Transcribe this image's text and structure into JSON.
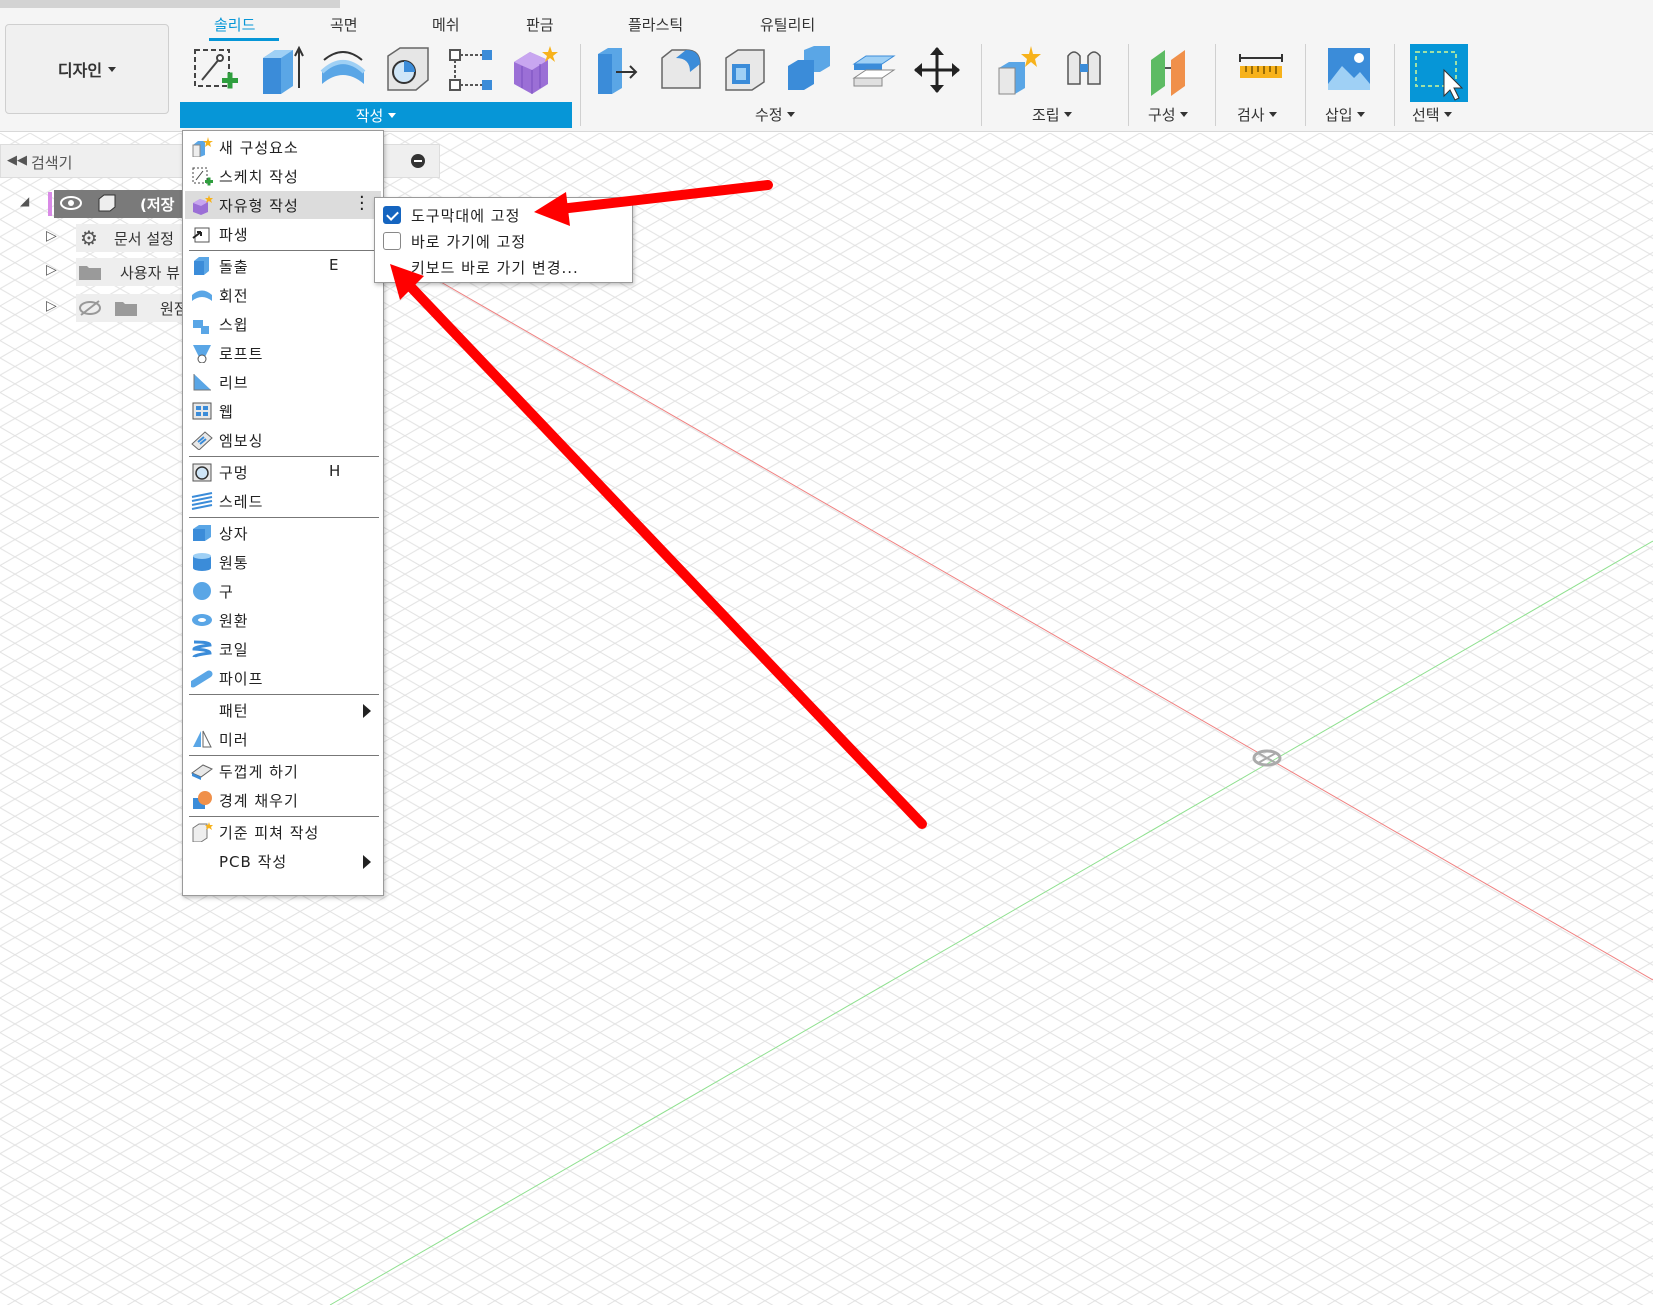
{
  "toolbar": {
    "workspace_label": "디자인",
    "tabs": [
      "솔리드",
      "곡면",
      "메쉬",
      "판금",
      "플라스틱",
      "유틸리티"
    ],
    "active_tab": "솔리드",
    "groups": {
      "create": "작성",
      "modify": "수정",
      "assemble": "조립",
      "construct": "구성",
      "inspect": "검사",
      "insert": "삽입",
      "select": "선택"
    },
    "accent_color": "#0696d7"
  },
  "browser": {
    "title": "검색기",
    "items": [
      {
        "label": "(저장",
        "icon": "component-icon"
      },
      {
        "label": "문서 설정",
        "icon": "gear-icon"
      },
      {
        "label": "사용자 뷰",
        "icon": "folder-icon"
      },
      {
        "label": "원점",
        "icon": "folder-icon"
      }
    ]
  },
  "create_menu": {
    "items": [
      {
        "label": "새 구성요소",
        "shortcut": ""
      },
      {
        "label": "스케치 작성",
        "shortcut": ""
      },
      {
        "label": "자유형 작성",
        "shortcut": ""
      },
      {
        "label": "파생",
        "shortcut": ""
      },
      {
        "label": "돌출",
        "shortcut": "E"
      },
      {
        "label": "회전",
        "shortcut": ""
      },
      {
        "label": "스윕",
        "shortcut": ""
      },
      {
        "label": "로프트",
        "shortcut": ""
      },
      {
        "label": "리브",
        "shortcut": ""
      },
      {
        "label": "웹",
        "shortcut": ""
      },
      {
        "label": "엠보싱",
        "shortcut": ""
      },
      {
        "label": "구멍",
        "shortcut": "H"
      },
      {
        "label": "스레드",
        "shortcut": ""
      },
      {
        "label": "상자",
        "shortcut": ""
      },
      {
        "label": "원통",
        "shortcut": ""
      },
      {
        "label": "구",
        "shortcut": ""
      },
      {
        "label": "원환",
        "shortcut": ""
      },
      {
        "label": "코일",
        "shortcut": ""
      },
      {
        "label": "파이프",
        "shortcut": ""
      },
      {
        "label": "패턴",
        "shortcut": ""
      },
      {
        "label": "미러",
        "shortcut": ""
      },
      {
        "label": "두껍게 하기",
        "shortcut": ""
      },
      {
        "label": "경계 채우기",
        "shortcut": ""
      },
      {
        "label": "기준 피쳐 작성",
        "shortcut": ""
      },
      {
        "label": "PCB 작성",
        "shortcut": ""
      }
    ]
  },
  "pin_submenu": {
    "pin_to_toolbar": {
      "label": "도구막대에 고정",
      "checked": true
    },
    "pin_to_shortcuts": {
      "label": "바로 가기에 고정",
      "checked": false
    },
    "change_shortcut": {
      "label": "키보드 바로 가기 변경..."
    }
  },
  "annotation_color": "#ff0000"
}
